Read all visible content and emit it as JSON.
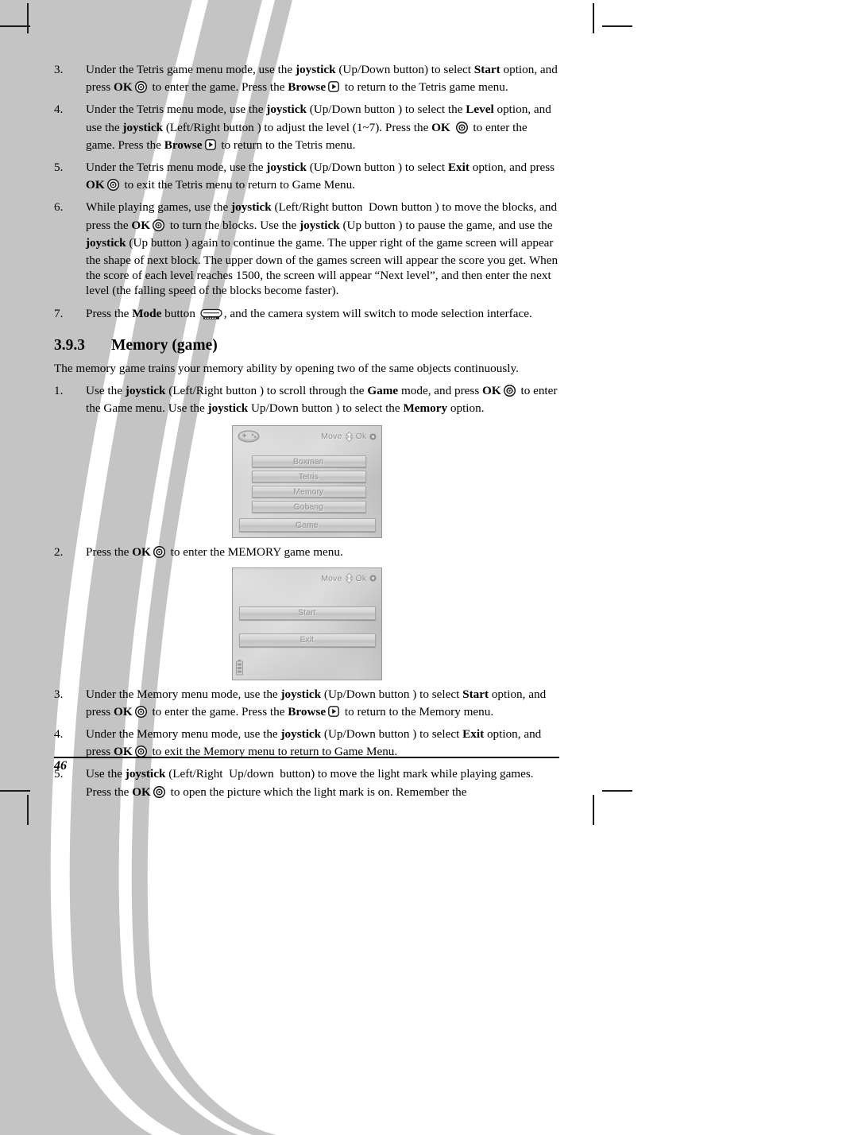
{
  "page": {
    "number": "46"
  },
  "icons": {
    "joystick": "joystick-dpad-icon",
    "ok": "ok-button-icon",
    "browse": "browse-button-icon",
    "mode": "mode-button-icon",
    "gamepad": "gamepad-icon",
    "updown_arrow": "up-down-arrow-icon",
    "battery": "battery-icon"
  },
  "list_tetris": [
    {
      "num": "3.",
      "parts": [
        {
          "t": "Under the Tetris game menu mode, use the "
        },
        {
          "t": "joystick",
          "b": true
        },
        {
          "t": " (Up/Down button"
        },
        {
          "icon": "joystick"
        },
        {
          "t": ") to select "
        },
        {
          "t": "Start",
          "b": true
        },
        {
          "t": " option, and press "
        },
        {
          "t": "OK",
          "b": true
        },
        {
          "icon": "ok"
        },
        {
          "t": " to enter the game. Press the "
        },
        {
          "t": "Browse",
          "b": true
        },
        {
          "icon": "browse"
        },
        {
          "t": " to return to the Tetris game menu."
        }
      ]
    },
    {
      "num": "4.",
      "parts": [
        {
          "t": "Under the Tetris menu mode, use the "
        },
        {
          "t": "joystick",
          "b": true
        },
        {
          "t": " (Up/Down button "
        },
        {
          "icon": "joystick"
        },
        {
          "t": ") to select the "
        },
        {
          "t": "Level",
          "b": true
        },
        {
          "t": " option, and use the "
        },
        {
          "t": "joystick",
          "b": true
        },
        {
          "t": " (Left/Right button "
        },
        {
          "icon": "joystick"
        },
        {
          "t": ") to adjust the level (1~7). Press the "
        },
        {
          "t": "OK",
          "b": true
        },
        {
          "t": " "
        },
        {
          "icon": "ok"
        },
        {
          "t": " to enter the game. Press the "
        },
        {
          "t": "Browse",
          "b": true
        },
        {
          "icon": "browse"
        },
        {
          "t": " to return to the Tetris menu."
        }
      ]
    },
    {
      "num": "5.",
      "parts": [
        {
          "t": "Under the Tetris menu mode, use the "
        },
        {
          "t": "joystick",
          "b": true
        },
        {
          "t": " (Up/Down button "
        },
        {
          "icon": "joystick"
        },
        {
          "t": ") to select "
        },
        {
          "t": "Exit",
          "b": true
        },
        {
          "t": " option, and press "
        },
        {
          "t": "OK",
          "b": true
        },
        {
          "icon": "ok"
        },
        {
          "t": " to exit the Tetris menu to return to Game Menu."
        }
      ]
    },
    {
      "num": "6.",
      "parts": [
        {
          "t": "While playing games, use the "
        },
        {
          "t": "joystick",
          "b": true
        },
        {
          "t": " (Left/Right button "
        },
        {
          "icon": "joystick"
        },
        {
          "t": " Down button "
        },
        {
          "icon": "joystick"
        },
        {
          "t": ") to move the blocks, and press the "
        },
        {
          "t": "OK",
          "b": true
        },
        {
          "icon": "ok"
        },
        {
          "t": " to turn the blocks. Use the "
        },
        {
          "t": "joystick",
          "b": true
        },
        {
          "t": " (Up button "
        },
        {
          "icon": "joystick"
        },
        {
          "t": ") to pause the game, and use the "
        },
        {
          "t": "joystick",
          "b": true
        },
        {
          "t": " (Up button "
        },
        {
          "icon": "joystick"
        },
        {
          "t": ") again to continue the game. The upper right of the game screen will appear the shape of next block. The upper down of the games screen will appear the score you get. When the score of each level reaches 1500, the screen will appear “Next level”, and then enter the next level (the falling speed of the blocks become faster)."
        }
      ]
    },
    {
      "num": "7.",
      "parts": [
        {
          "t": "Press the "
        },
        {
          "t": "Mode",
          "b": true
        },
        {
          "t": " button "
        },
        {
          "icon": "mode"
        },
        {
          "t": ", and the camera system will switch to mode selection interface."
        }
      ]
    }
  ],
  "section": {
    "number": "3.9.3",
    "title": "Memory (game)",
    "intro": "The memory game trains your memory ability by opening two of the same objects continuously."
  },
  "list_memory_1": [
    {
      "num": "1.",
      "parts": [
        {
          "t": "Use the "
        },
        {
          "t": "joystick",
          "b": true
        },
        {
          "t": " (Left/Right button "
        },
        {
          "icon": "joystick"
        },
        {
          "t": ") to scroll through the "
        },
        {
          "t": "Game",
          "b": true
        },
        {
          "t": " mode, and press "
        },
        {
          "t": "OK",
          "b": true
        },
        {
          "icon": "ok"
        },
        {
          "t": " to enter the Game menu. Use the "
        },
        {
          "t": "joystick",
          "b": true
        },
        {
          "t": " Up/Down button "
        },
        {
          "icon": "joystick"
        },
        {
          "t": ") to select the "
        },
        {
          "t": "Memory",
          "b": true
        },
        {
          "t": " option."
        }
      ]
    }
  ],
  "list_memory_2": [
    {
      "num": "2.",
      "parts": [
        {
          "t": "Press the "
        },
        {
          "t": "OK",
          "b": true
        },
        {
          "icon": "ok"
        },
        {
          "t": " to enter the MEMORY game menu."
        }
      ]
    }
  ],
  "list_memory_3": [
    {
      "num": "3.",
      "parts": [
        {
          "t": "Under the Memory menu mode, use the "
        },
        {
          "t": "joystick",
          "b": true
        },
        {
          "t": " (Up/Down button "
        },
        {
          "icon": "joystick"
        },
        {
          "t": ") to select "
        },
        {
          "t": "Start",
          "b": true
        },
        {
          "t": " option, and press "
        },
        {
          "t": "OK",
          "b": true
        },
        {
          "icon": "ok"
        },
        {
          "t": " to enter the game. Press the "
        },
        {
          "t": "Browse",
          "b": true
        },
        {
          "icon": "browse"
        },
        {
          "t": " to return to the Memory menu."
        }
      ]
    },
    {
      "num": "4.",
      "parts": [
        {
          "t": "Under the Memory menu mode, use the "
        },
        {
          "t": "joystick",
          "b": true
        },
        {
          "t": " (Up/Down button "
        },
        {
          "icon": "joystick"
        },
        {
          "t": ") to select "
        },
        {
          "t": "Exit",
          "b": true
        },
        {
          "t": " option, and press "
        },
        {
          "t": "OK",
          "b": true
        },
        {
          "icon": "ok"
        },
        {
          "t": " to exit the Memory menu to return to Game Menu."
        }
      ]
    },
    {
      "num": "5.",
      "parts": [
        {
          "t": "Use the "
        },
        {
          "t": "joystick",
          "b": true
        },
        {
          "t": " (Left/Right "
        },
        {
          "icon": "joystick"
        },
        {
          "t": " Up/down "
        },
        {
          "icon": "joystick"
        },
        {
          "t": " button) to move the light mark while playing games. Press the "
        },
        {
          "t": "OK",
          "b": true
        },
        {
          "icon": "ok"
        },
        {
          "t": " to open the picture which the light mark is on. Remember the"
        }
      ]
    }
  ],
  "screenshot_game_menu": {
    "header": {
      "move_label": "Move",
      "ok_label": "Ok"
    },
    "items": [
      "Boxman",
      "Tetris",
      "Memory",
      "Gobang"
    ],
    "footer_item": "Game"
  },
  "screenshot_memory_menu": {
    "header": {
      "move_label": "Move",
      "ok_label": "Ok"
    },
    "items": [
      "Start",
      "Exit"
    ]
  }
}
